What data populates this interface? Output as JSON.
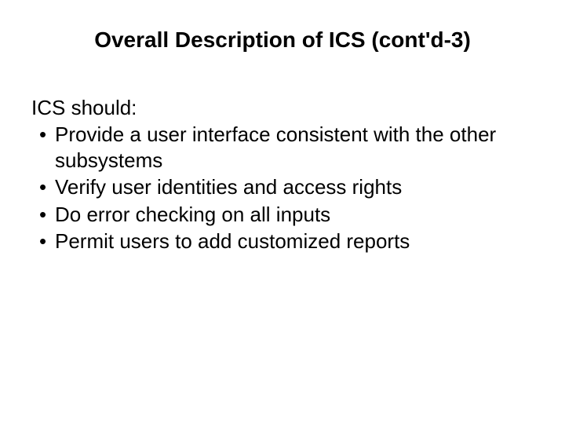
{
  "slide": {
    "title": "Overall Description of ICS (cont'd-3)",
    "intro": "ICS should:",
    "bullets": [
      "Provide a user interface consistent with the other subsystems",
      "Verify user identities and access rights",
      "Do error checking on all inputs",
      "Permit users to add customized reports"
    ]
  }
}
